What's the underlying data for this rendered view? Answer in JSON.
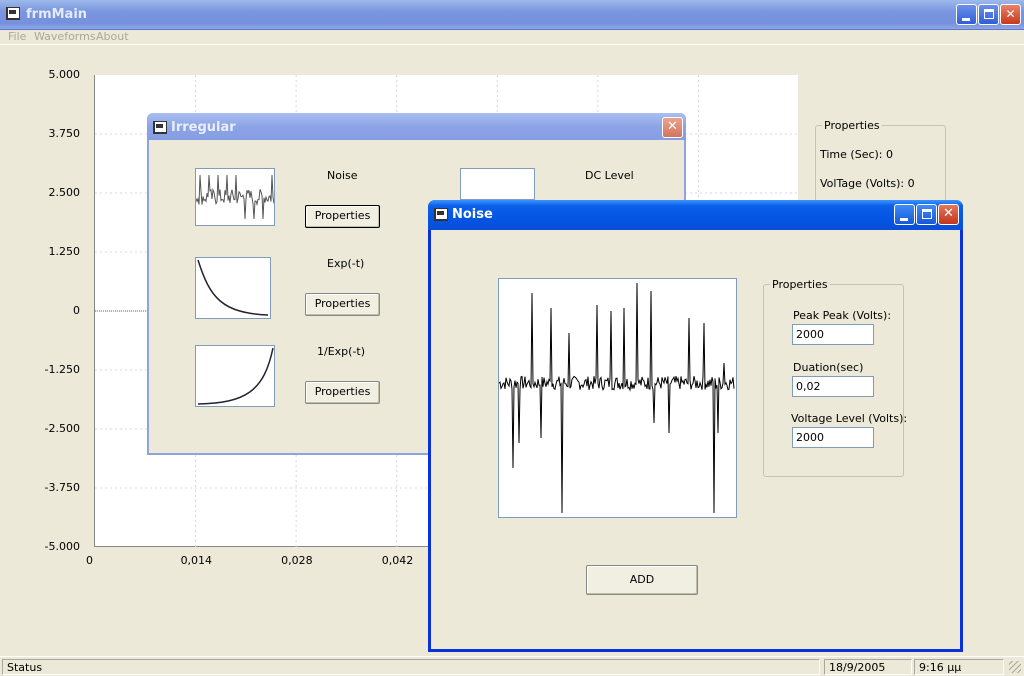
{
  "main_window": {
    "title": "frmMain",
    "menu": [
      "File",
      "Waveforms",
      "About"
    ]
  },
  "chart_data": {
    "type": "line",
    "title": "",
    "xlabel": "",
    "ylabel": "",
    "y_tick_labels": [
      "5.000",
      "3.750",
      "2.500",
      "1.250",
      "0",
      "-1.250",
      "-2.500",
      "-3.750",
      "-5.000"
    ],
    "x_tick_labels": [
      "0",
      "0,014",
      "0,028",
      "0,042"
    ],
    "ylim": [
      -5,
      5
    ],
    "xlim": [
      0,
      0.07
    ],
    "grid": true,
    "series": [
      {
        "x": [
          0,
          0.009
        ],
        "y": [
          0,
          0
        ]
      }
    ]
  },
  "properties_panel": {
    "label": "Properties",
    "time_text": "Time (Sec): 0",
    "voltage_text": "VolTage (Volts): 0"
  },
  "irregular_window": {
    "title": "Irregular",
    "close_glyph": "✕",
    "waves": [
      {
        "label": "Noise",
        "button": "Properties"
      },
      {
        "label": "Exp(-t)",
        "button": "Properties"
      },
      {
        "label": "1/Exp(-t)",
        "button": "Properties"
      }
    ],
    "dc_label": "DC Level"
  },
  "noise_window": {
    "title": "Noise",
    "close_glyph": "✕",
    "group_label": "Properties",
    "fields": [
      {
        "label": "Peak Peak (Volts):",
        "value": "2000"
      },
      {
        "label": "Duation(sec)",
        "value": "0,02"
      },
      {
        "label": "Voltage Level (Volts):",
        "value": "2000"
      }
    ],
    "add_button": "ADD"
  },
  "status_bar": {
    "status": "Status",
    "date": "18/9/2005",
    "time": "9:16 μμ"
  }
}
